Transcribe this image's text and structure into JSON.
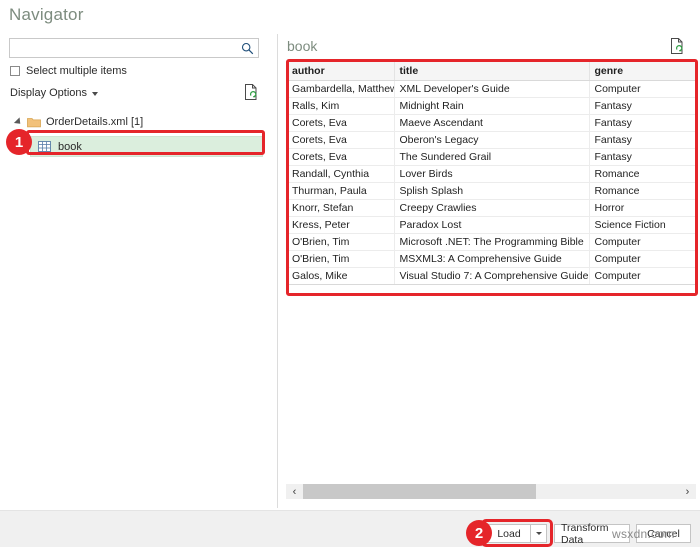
{
  "dialog": {
    "title": "Navigator"
  },
  "search": {
    "value": "",
    "placeholder": "",
    "icon": "search-icon"
  },
  "options": {
    "select_multiple_label": "Select multiple items",
    "select_multiple_checked": false,
    "display_options_label": "Display Options",
    "refresh_icon": "refresh-document-icon"
  },
  "tree": {
    "root": {
      "label": "OrderDetails.xml [1]",
      "icon": "folder-icon",
      "expanded": true
    },
    "children": [
      {
        "label": "book",
        "icon": "table-grid-icon",
        "selected": true
      }
    ]
  },
  "preview": {
    "title": "book",
    "refresh_icon": "refresh-document-icon",
    "columns": [
      "author",
      "title",
      "genre"
    ],
    "rows": [
      [
        "Gambardella, Matthew",
        "XML Developer's Guide",
        "Computer"
      ],
      [
        "Ralls, Kim",
        "Midnight Rain",
        "Fantasy"
      ],
      [
        "Corets, Eva",
        "Maeve Ascendant",
        "Fantasy"
      ],
      [
        "Corets, Eva",
        "Oberon's Legacy",
        "Fantasy"
      ],
      [
        "Corets, Eva",
        "The Sundered Grail",
        "Fantasy"
      ],
      [
        "Randall, Cynthia",
        "Lover Birds",
        "Romance"
      ],
      [
        "Thurman, Paula",
        "Splish Splash",
        "Romance"
      ],
      [
        "Knorr, Stefan",
        "Creepy Crawlies",
        "Horror"
      ],
      [
        "Kress, Peter",
        "Paradox Lost",
        "Science Fiction"
      ],
      [
        "O'Brien, Tim",
        "Microsoft .NET: The Programming Bible",
        "Computer"
      ],
      [
        "O'Brien, Tim",
        "MSXML3: A Comprehensive Guide",
        "Computer"
      ],
      [
        "Galos, Mike",
        "Visual Studio 7: A Comprehensive Guide",
        "Computer"
      ]
    ],
    "scrollbar": {
      "left_arrow": "‹",
      "right_arrow": "›",
      "thumb_fraction_percent": 62
    }
  },
  "footer": {
    "load_label": "Load",
    "load_dropdown_icon": "chevron-down-icon",
    "transform_label": "Transform Data",
    "cancel_label": "Cancel"
  },
  "annotations": {
    "badge_1": "1",
    "badge_2": "2",
    "color": "#e5252a"
  },
  "watermark": {
    "text": "wsxdn.com"
  }
}
